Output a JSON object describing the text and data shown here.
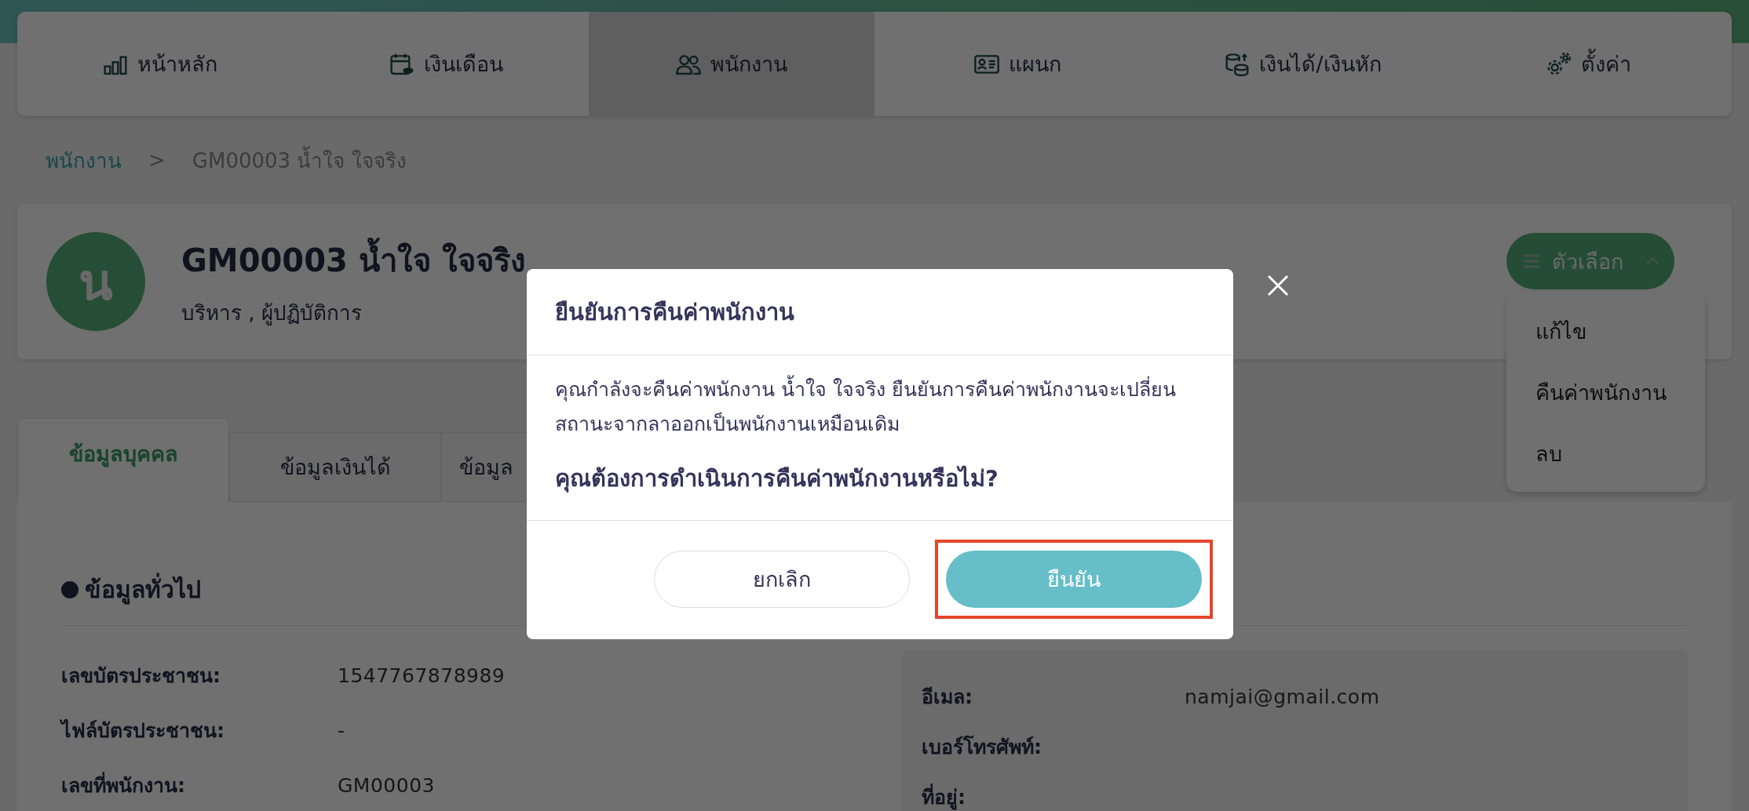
{
  "nav": {
    "items": [
      {
        "label": "หน้าหลัก",
        "selected": false
      },
      {
        "label": "เงินเดือน",
        "selected": false
      },
      {
        "label": "พนักงาน",
        "selected": true
      },
      {
        "label": "แผนก",
        "selected": false
      },
      {
        "label": "เงินได้/เงินหัก",
        "selected": false
      },
      {
        "label": "ตั้งค่า",
        "selected": false
      }
    ]
  },
  "breadcrumb": {
    "parent": "พนักงาน",
    "separator": ">",
    "current": "GM00003 น้ำใจ ใจจริง"
  },
  "profile": {
    "avatar_letter": "น",
    "name": "GM00003 น้ำใจ ใจจริง",
    "roles": "บริหาร , ผู้ปฏิบัติการ"
  },
  "options_menu": {
    "label": "ตัวเลือก",
    "expanded": true,
    "items": [
      "แก้ไข",
      "คืนค่าพนักงาน",
      "ลบ"
    ]
  },
  "tabs": [
    {
      "label": "ข้อมูลบุคคล",
      "selected": true
    },
    {
      "label": "ข้อมูลเงินได้",
      "selected": false
    },
    {
      "label": "ข้อมูล",
      "selected": false
    }
  ],
  "section": {
    "title": "ข้อมูลทั่วไป",
    "left_fields": [
      {
        "label": "เลขบัตรประชาชน:",
        "value": "1547767878989"
      },
      {
        "label": "ไฟล์บัตรประชาชน:",
        "value": "-"
      },
      {
        "label": "เลขที่พนักงาน:",
        "value": "GM00003"
      }
    ],
    "right_fields": [
      {
        "label": "อีเมล:",
        "value": "namjai@gmail.com"
      },
      {
        "label": "เบอร์โทรศัพท์:"
      },
      {
        "label": "ที่อยู่:"
      }
    ]
  },
  "dialog": {
    "title": "ยืนยันการคืนค่าพนักงาน",
    "message": "คุณกำลังจะคืนค่าพนักงาน น้ำใจ ใจจริง ยืนยันการคืนค่าพนักงานจะเปลี่ยนสถานะจากลาออกเป็นพนักงานเหมือนเดิม",
    "question": "คุณต้องการดำเนินการคืนค่าพนักงานหรือไม่?",
    "buttons": [
      {
        "label": "ยกเลิก",
        "kind": "secondary",
        "highlighted": false
      },
      {
        "label": "ยืนยัน",
        "kind": "primary",
        "highlighted": true
      }
    ]
  }
}
